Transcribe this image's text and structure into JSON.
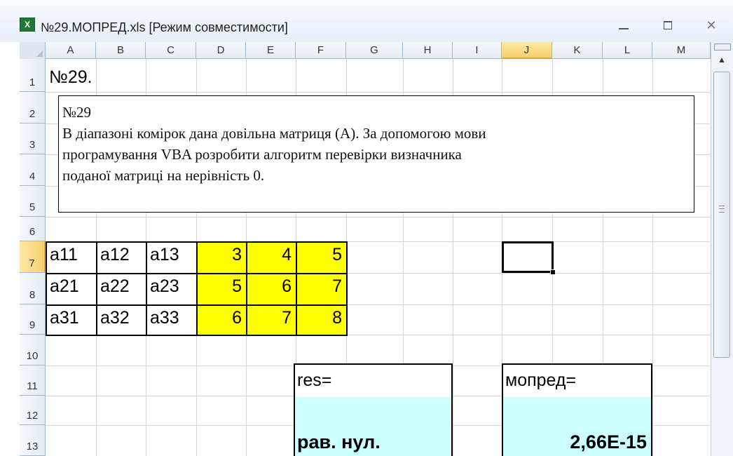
{
  "window": {
    "title": "№29.МОПРЕД.xls  [Режим совместимости]",
    "controls": {
      "minimize": "minimize",
      "maximize": "maximize",
      "close": "close"
    }
  },
  "columns": [
    "A",
    "B",
    "C",
    "D",
    "E",
    "F",
    "G",
    "H",
    "I",
    "J",
    "K",
    "L",
    "M"
  ],
  "rows": [
    "1",
    "2",
    "3",
    "4",
    "5",
    "6",
    "7",
    "8",
    "9",
    "10",
    "11",
    "12",
    "13"
  ],
  "cells": {
    "A1": "№29.",
    "A7": "a11",
    "B7": "a12",
    "C7": "a13",
    "A8": "a21",
    "B8": "a22",
    "C8": "a23",
    "A9": "a31",
    "B9": "a32",
    "C9": "a33",
    "D7": "3",
    "E7": "4",
    "F7": "5",
    "D8": "5",
    "E8": "6",
    "F8": "7",
    "D9": "6",
    "E9": "7",
    "F9": "8",
    "F11": "res=",
    "F13": "рав. нул.",
    "J11": "мопред=",
    "J13": "2,66E-15"
  },
  "textbox": {
    "lines": [
      "№29",
      "В діапазоні комірок дана довільна матриця (А). За допомогою мови",
      "програмування VBA  розробити алгоритм перевірки визначника",
      "поданої матриці на нерівність 0."
    ]
  },
  "active_cell": "J7",
  "colors": {
    "matrix_fill": "#ffff00",
    "result_fill": "#ccffff",
    "header_active": "#f6cf6b"
  }
}
